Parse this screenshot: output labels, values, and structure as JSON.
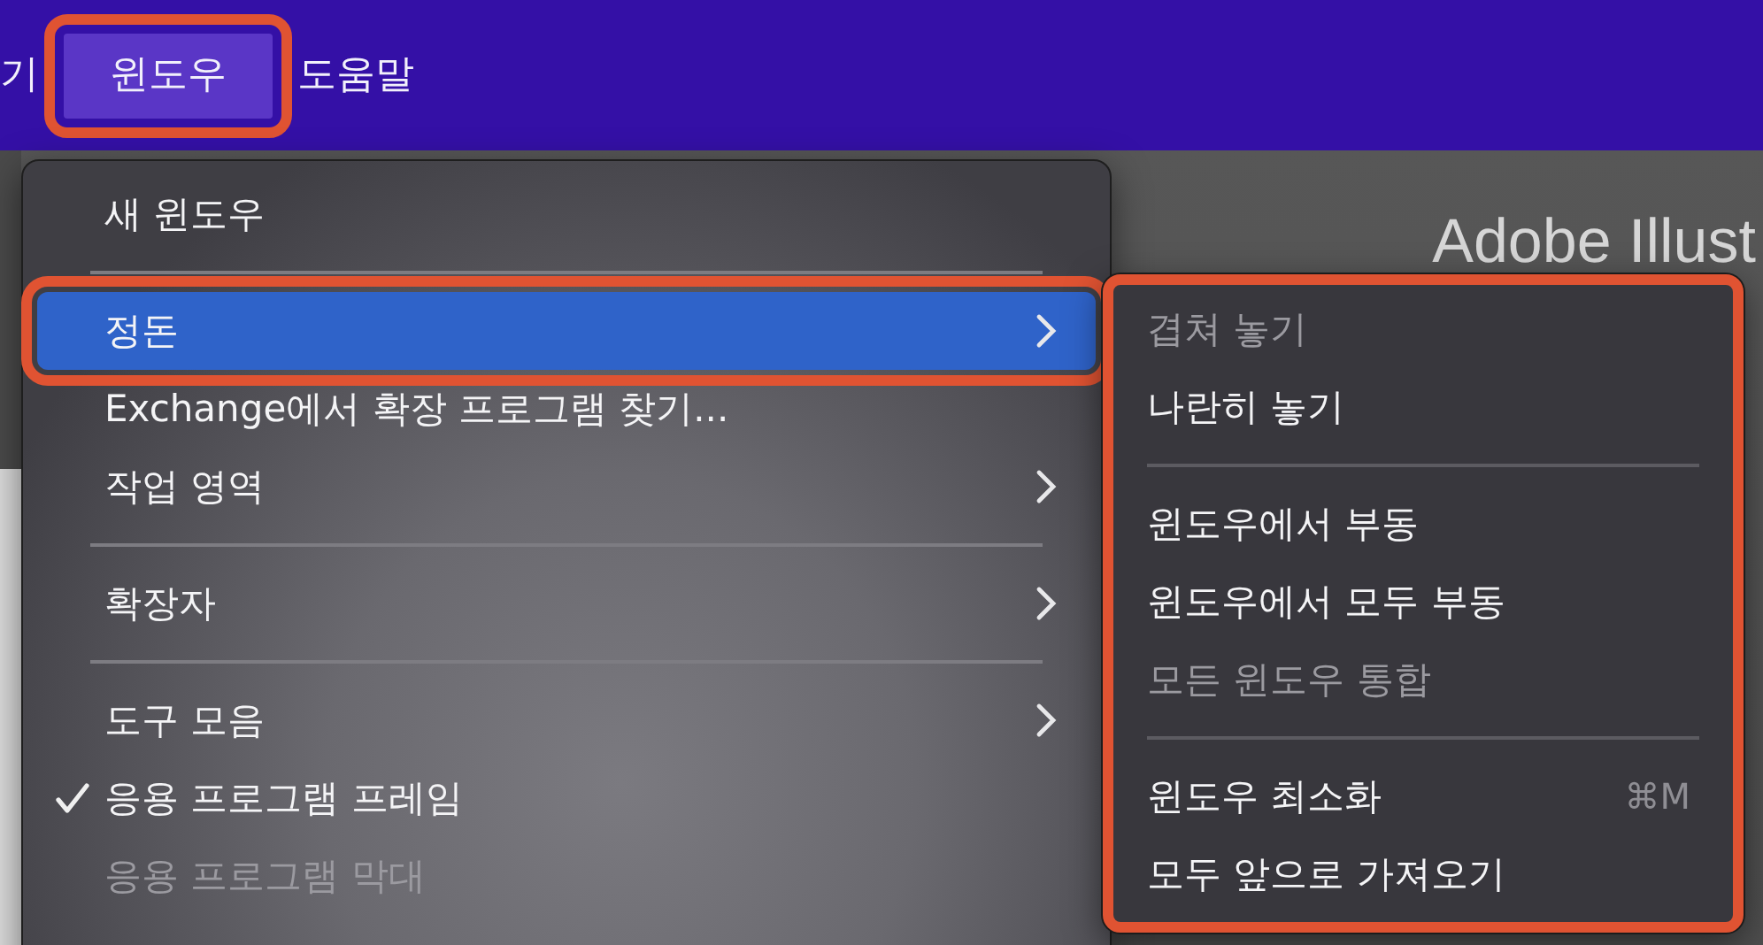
{
  "menu_bar": [
    {
      "label": "기",
      "selected": false
    },
    {
      "label": "윈도우",
      "selected": true
    },
    {
      "label": "도움말",
      "selected": false
    }
  ],
  "app_title": "Adobe Illust",
  "window_menu": [
    {
      "kind": "item",
      "label": "새 윈도우",
      "selected": false,
      "disabled": false,
      "checked": false,
      "submenu": false
    },
    {
      "kind": "separator"
    },
    {
      "kind": "item",
      "label": "정돈",
      "selected": true,
      "disabled": false,
      "checked": false,
      "submenu": true
    },
    {
      "kind": "item",
      "label": "Exchange에서 확장 프로그램 찾기...",
      "selected": false,
      "disabled": false,
      "checked": false,
      "submenu": false
    },
    {
      "kind": "item",
      "label": "작업 영역",
      "selected": false,
      "disabled": false,
      "checked": false,
      "submenu": true
    },
    {
      "kind": "separator"
    },
    {
      "kind": "item",
      "label": "확장자",
      "selected": false,
      "disabled": false,
      "checked": false,
      "submenu": true
    },
    {
      "kind": "separator"
    },
    {
      "kind": "item",
      "label": "도구 모음",
      "selected": false,
      "disabled": false,
      "checked": false,
      "submenu": true
    },
    {
      "kind": "item",
      "label": "응용 프로그램 프레임",
      "selected": false,
      "disabled": false,
      "checked": true,
      "submenu": false
    },
    {
      "kind": "item",
      "label": "응용 프로그램 막대",
      "selected": false,
      "disabled": true,
      "checked": false,
      "submenu": false
    }
  ],
  "arrange_submenu": [
    {
      "kind": "item",
      "label": "겹쳐 놓기",
      "disabled": true
    },
    {
      "kind": "item",
      "label": "나란히 놓기",
      "disabled": false
    },
    {
      "kind": "separator"
    },
    {
      "kind": "item",
      "label": "윈도우에서 부동",
      "disabled": false
    },
    {
      "kind": "item",
      "label": "윈도우에서 모두 부동",
      "disabled": false
    },
    {
      "kind": "item",
      "label": "모든 윈도우 통합",
      "disabled": true
    },
    {
      "kind": "separator"
    },
    {
      "kind": "item",
      "label": "윈도우 최소화",
      "disabled": false,
      "shortcut": "⌘M"
    },
    {
      "kind": "item",
      "label": "모두 앞으로 가져오기",
      "disabled": false
    }
  ]
}
